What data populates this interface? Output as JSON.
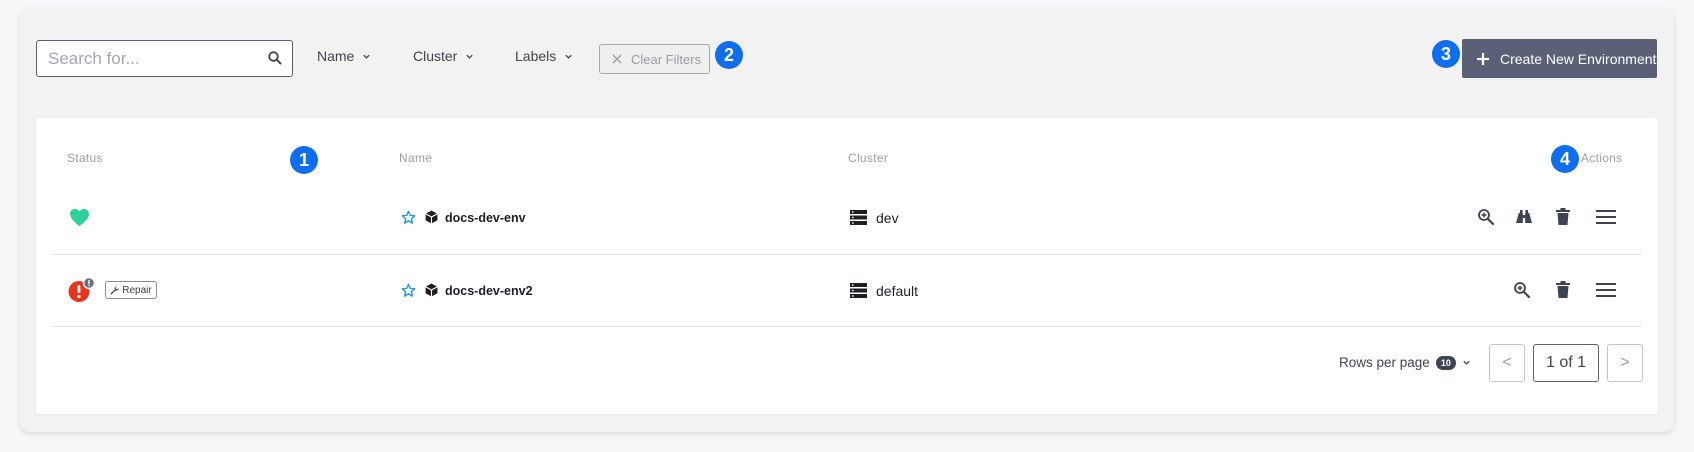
{
  "toolbar": {
    "search_placeholder": "Search for...",
    "filters": [
      {
        "label": "Name"
      },
      {
        "label": "Cluster"
      },
      {
        "label": "Labels"
      }
    ],
    "clear_filters_label": "Clear Filters",
    "create_label": "Create New Environment"
  },
  "callouts": [
    "1",
    "2",
    "3",
    "4"
  ],
  "table": {
    "headers": {
      "status": "Status",
      "name": "Name",
      "cluster": "Cluster",
      "actions": "Actions"
    },
    "rows": [
      {
        "name": "docs-dev-env",
        "cluster": "dev",
        "status": "healthy"
      },
      {
        "name": "docs-dev-env2",
        "cluster": "default",
        "status": "error",
        "status_tag": "Repair"
      }
    ]
  },
  "pagination": {
    "rows_per_page_label": "Rows per page",
    "rows_per_page_value": "10",
    "prev_label": "<",
    "next_label": ">",
    "page_label": "1 of 1"
  },
  "colors": {
    "accent_blue": "#0f6ef0",
    "healthy_green": "#2ed19a",
    "error_red": "#e8341c",
    "primary_button": "#5a6075",
    "star_blue": "#1a9bd7"
  },
  "icons": {
    "search": "search-icon",
    "chevron": "chevron-down-icon",
    "clear": "close-icon",
    "create": "plus-icon",
    "healthy": "heart-icon",
    "error": "exclamation-icon",
    "repair": "wrench-icon",
    "favorite": "star-icon",
    "environment": "cube-icon",
    "cluster": "server-icon",
    "inspect": "zoom-in-icon",
    "observe": "binoculars-icon",
    "delete": "trash-icon",
    "menu": "hamburger-menu-icon"
  }
}
